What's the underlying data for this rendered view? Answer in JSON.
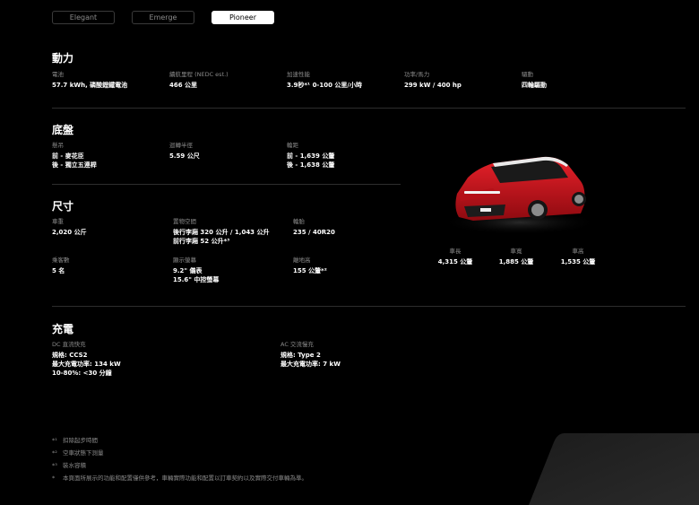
{
  "tabs": [
    {
      "label": "Elegant"
    },
    {
      "label": "Emerge"
    },
    {
      "label": "Pioneer"
    }
  ],
  "power": {
    "title": "動力",
    "items": [
      {
        "label": "電池",
        "value": "57.7 kWh, 磷酸鋰鐵電池"
      },
      {
        "label": "續航里程 (NEDC est.)",
        "value": "466 公里"
      },
      {
        "label": "加速性能",
        "value": "3.9秒*¹ 0-100 公里/小時"
      },
      {
        "label": "功率/馬力",
        "value": "299 kW / 400 hp"
      },
      {
        "label": "驅動",
        "value": "四輪驅動"
      }
    ]
  },
  "chassis": {
    "title": "底盤",
    "items": [
      {
        "label": "懸吊",
        "value": "前 - 麥花臣\n後 - 獨立五連桿"
      },
      {
        "label": "迴轉半徑",
        "value": "5.59 公尺"
      },
      {
        "label": "輪距",
        "value": "前 - 1,639 公釐\n後 - 1,638 公釐"
      }
    ]
  },
  "size": {
    "title": "尺寸",
    "items": [
      {
        "label": "車重",
        "value": "2,020 公斤"
      },
      {
        "label": "置物空間",
        "value": "後行李廂 320 公升 / 1,043 公升\n前行李廂 52 公升*³"
      },
      {
        "label": "輪胎",
        "value": "235 / 40R20"
      },
      {
        "label": "乘客數",
        "value": "5 名"
      },
      {
        "label": "顯示螢幕",
        "value": "9.2\" 儀表\n15.6\" 中控螢幕"
      },
      {
        "label": "離地高",
        "value": "155 公釐*²"
      }
    ]
  },
  "dimensions": [
    {
      "label": "車長",
      "value": "4,315 公釐"
    },
    {
      "label": "車寬",
      "value": "1,885 公釐"
    },
    {
      "label": "車高",
      "value": "1,535 公釐"
    }
  ],
  "charging": {
    "title": "充電",
    "items": [
      {
        "label": "DC 直流快充",
        "value": "規格: CCS2\n最大充電功率: 134 kW\n10-80%: <30 分鐘"
      },
      {
        "label": "AC 交流慢充",
        "value": "規格: Type 2\n最大充電功率: 7 kW"
      }
    ]
  },
  "footnotes": [
    {
      "mark": "*¹",
      "text": "扣除起步時間"
    },
    {
      "mark": "*²",
      "text": "空車狀態下測量"
    },
    {
      "mark": "*³",
      "text": "裝水容積"
    },
    {
      "mark": "*",
      "text": "本頁面所展示的功能和配置僅供參考，車輛實際功能和配置以訂車契約以及實際交付車輛為準。"
    }
  ],
  "colors": {
    "car_body": "#d0141c",
    "accent": "#ffffff",
    "muted": "#8a8a8a"
  }
}
